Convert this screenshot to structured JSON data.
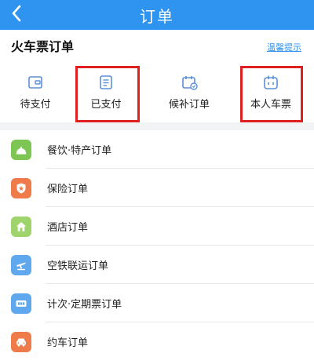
{
  "header": {
    "title": "订单"
  },
  "train": {
    "section_title": "火车票订单",
    "link_text": "温馨提示",
    "quick_items": [
      {
        "label": "待支付",
        "icon": "wallet-icon"
      },
      {
        "label": "已支付",
        "icon": "document-icon"
      },
      {
        "label": "候补订单",
        "icon": "calendar-icon"
      },
      {
        "label": "本人车票",
        "icon": "ticket-icon"
      }
    ]
  },
  "colors": {
    "header": "#2f93f0",
    "highlight": "#e02020",
    "icon_blue": "#5b8fd8"
  },
  "other_orders": [
    {
      "label": "餐饮·特产订单",
      "icon": "food-cover-icon",
      "color": "#7dc653"
    },
    {
      "label": "保险订单",
      "icon": "shield-icon",
      "color": "#f07b4a"
    },
    {
      "label": "酒店订单",
      "icon": "house-icon",
      "color": "#9ed46b"
    },
    {
      "label": "空铁联运订单",
      "icon": "plane-train-icon",
      "color": "#5fa8ee"
    },
    {
      "label": "计次·定期票订单",
      "icon": "tickets-icon",
      "color": "#5fa8ee"
    },
    {
      "label": "约车订单",
      "icon": "car-icon",
      "color": "#f07b4a"
    }
  ]
}
